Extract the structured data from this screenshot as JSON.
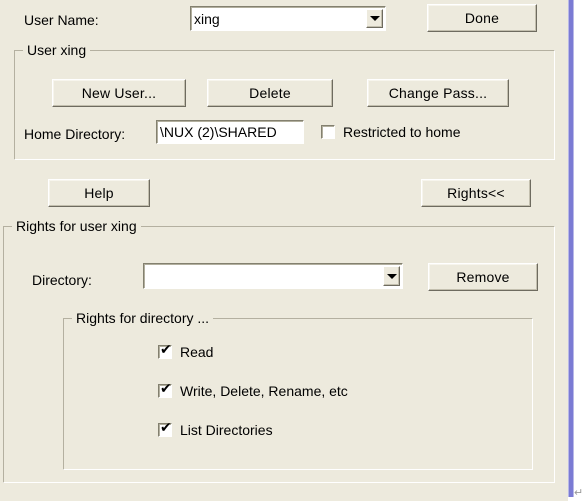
{
  "dialog": {
    "background_color": "#edeadd",
    "frame_accent_color": "#7b7bd4",
    "end_mark": "↵"
  },
  "top_row": {
    "user_name_label": "User Name:",
    "user_name_value": "xing",
    "user_name_placeholder": "",
    "dropdown_icon": "chevron-down-icon",
    "done_label": "Done"
  },
  "user_group": {
    "title": "User xing",
    "new_user_label": "New User...",
    "delete_label": "Delete",
    "change_pass_label": "Change Pass...",
    "home_directory_label": "Home Directory:",
    "home_directory_value": "\\NUX (2)\\SHARED",
    "home_directory_placeholder": "",
    "restricted_label": "Restricted to home",
    "restricted_checked": false
  },
  "middle_row": {
    "help_label": "Help",
    "rights_label": "Rights<<"
  },
  "rights_group": {
    "title": "Rights for user xing",
    "directory_label": "Directory:",
    "directory_value": "",
    "directory_placeholder": "",
    "dropdown_icon": "chevron-down-icon",
    "remove_label": "Remove",
    "directory_rights": {
      "title": "Rights for directory ...",
      "items": [
        {
          "label": "Read",
          "checked": true,
          "tick": "✔"
        },
        {
          "label": "Write, Delete, Rename, etc",
          "checked": true,
          "tick": "✔"
        },
        {
          "label": "List Directories",
          "checked": true,
          "tick": "✔"
        }
      ]
    }
  }
}
